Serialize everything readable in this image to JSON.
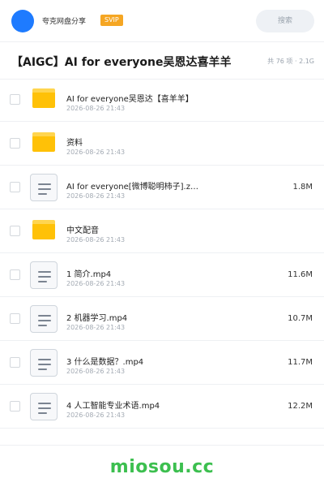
{
  "header": {
    "brand": "夸克网盘分享",
    "badge": "SVIP",
    "search_placeholder": "搜索"
  },
  "share": {
    "title": "【AIGC】AI for everyone吴恩达喜羊羊",
    "meta": "共 76 项 · 2.1G"
  },
  "files": [
    {
      "type": "folder",
      "name": "AI for everyone吴恩达【喜羊羊】",
      "date": "2026-08-26 21:43",
      "size": ""
    },
    {
      "type": "folder",
      "name": "资料",
      "date": "2026-08-26 21:43",
      "size": ""
    },
    {
      "type": "file",
      "name": "AI for everyone[微博聪明柿子].z…",
      "date": "2026-08-26 21:43",
      "size": "1.8M"
    },
    {
      "type": "folder",
      "name": "中文配音",
      "date": "2026-08-26 21:43",
      "size": ""
    },
    {
      "type": "file",
      "name": "1 简介.mp4",
      "date": "2026-08-26 21:43",
      "size": "11.6M"
    },
    {
      "type": "file",
      "name": "2 机器学习.mp4",
      "date": "2026-08-26 21:43",
      "size": "10.7M"
    },
    {
      "type": "file",
      "name": "3 什么是数据？.mp4",
      "date": "2026-08-26 21:43",
      "size": "11.7M"
    },
    {
      "type": "file",
      "name": "4 人工智能专业术语.mp4",
      "date": "2026-08-26 21:43",
      "size": "12.2M"
    }
  ],
  "footer": {
    "watermark": "miosou.cc"
  },
  "colors": {
    "accent": "#1e7bff",
    "badge": "#f5a623",
    "folder": "#ffc107",
    "watermark": "#3cbf4f"
  },
  "icons": {
    "folder": "folder-icon",
    "file": "file-icon"
  }
}
